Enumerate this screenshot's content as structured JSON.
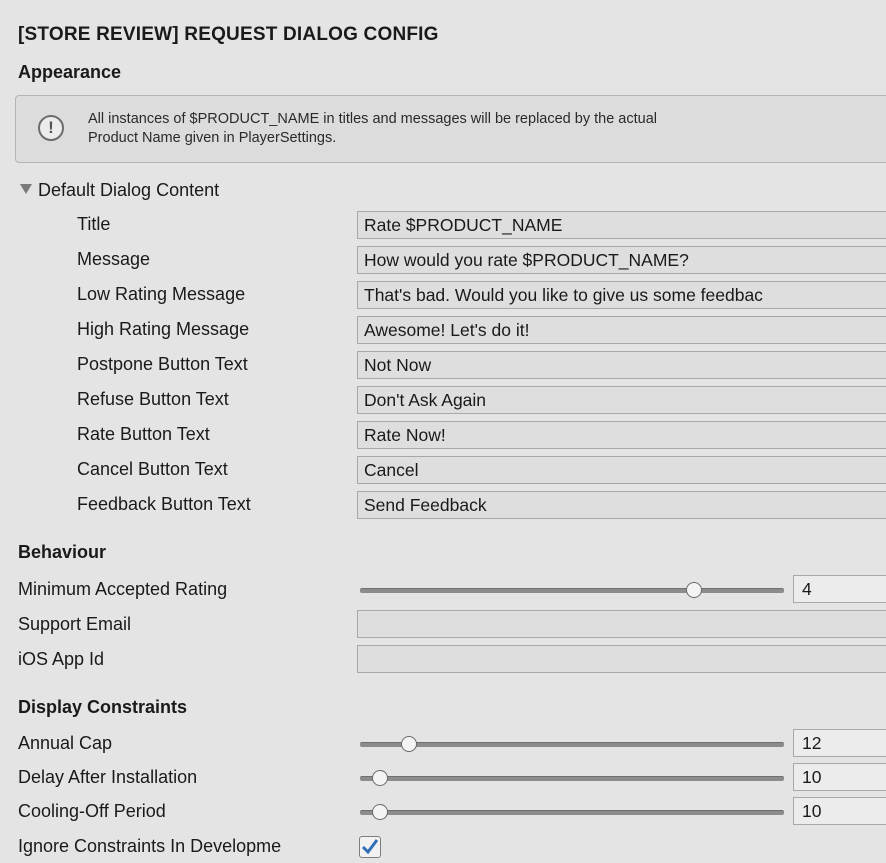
{
  "header": {
    "title": "[STORE REVIEW] REQUEST DIALOG CONFIG"
  },
  "appearance": {
    "heading": "Appearance",
    "help": {
      "icon": "info-icon",
      "line1": "All instances of $PRODUCT_NAME in titles and messages will be replaced by the actual",
      "line2": "Product Name given in PlayerSettings."
    },
    "foldout_label": "Default Dialog Content",
    "fields": [
      {
        "label": "Title",
        "value": "Rate $PRODUCT_NAME"
      },
      {
        "label": "Message",
        "value": "How would you rate $PRODUCT_NAME?"
      },
      {
        "label": "Low Rating Message",
        "value": "That's bad. Would you like to give us some feedbac"
      },
      {
        "label": "High Rating Message",
        "value": "Awesome! Let's do it!"
      },
      {
        "label": "Postpone Button Text",
        "value": "Not Now"
      },
      {
        "label": "Refuse Button Text",
        "value": "Don't Ask Again"
      },
      {
        "label": "Rate Button Text",
        "value": "Rate Now!"
      },
      {
        "label": "Cancel Button Text",
        "value": "Cancel"
      },
      {
        "label": "Feedback Button Text",
        "value": "Send Feedback"
      }
    ]
  },
  "behaviour": {
    "heading": "Behaviour",
    "min_rating": {
      "label": "Minimum Accepted Rating",
      "value": "4",
      "fraction": 0.8
    },
    "support_email": {
      "label": "Support Email",
      "value": ""
    },
    "ios_app_id": {
      "label": "iOS App Id",
      "value": ""
    }
  },
  "constraints": {
    "heading": "Display Constraints",
    "annual_cap": {
      "label": "Annual Cap",
      "value": "12",
      "fraction": 0.1
    },
    "delay_after_install": {
      "label": "Delay After Installation",
      "value": "10",
      "fraction": 0.03
    },
    "cooling_off": {
      "label": "Cooling-Off Period",
      "value": "10",
      "fraction": 0.03
    },
    "ignore_in_dev": {
      "label": "Ignore Constraints In Developme",
      "checked": true
    }
  },
  "colors": {
    "checkmark": "#2f6fb5",
    "panel": "#e4e4e4"
  }
}
